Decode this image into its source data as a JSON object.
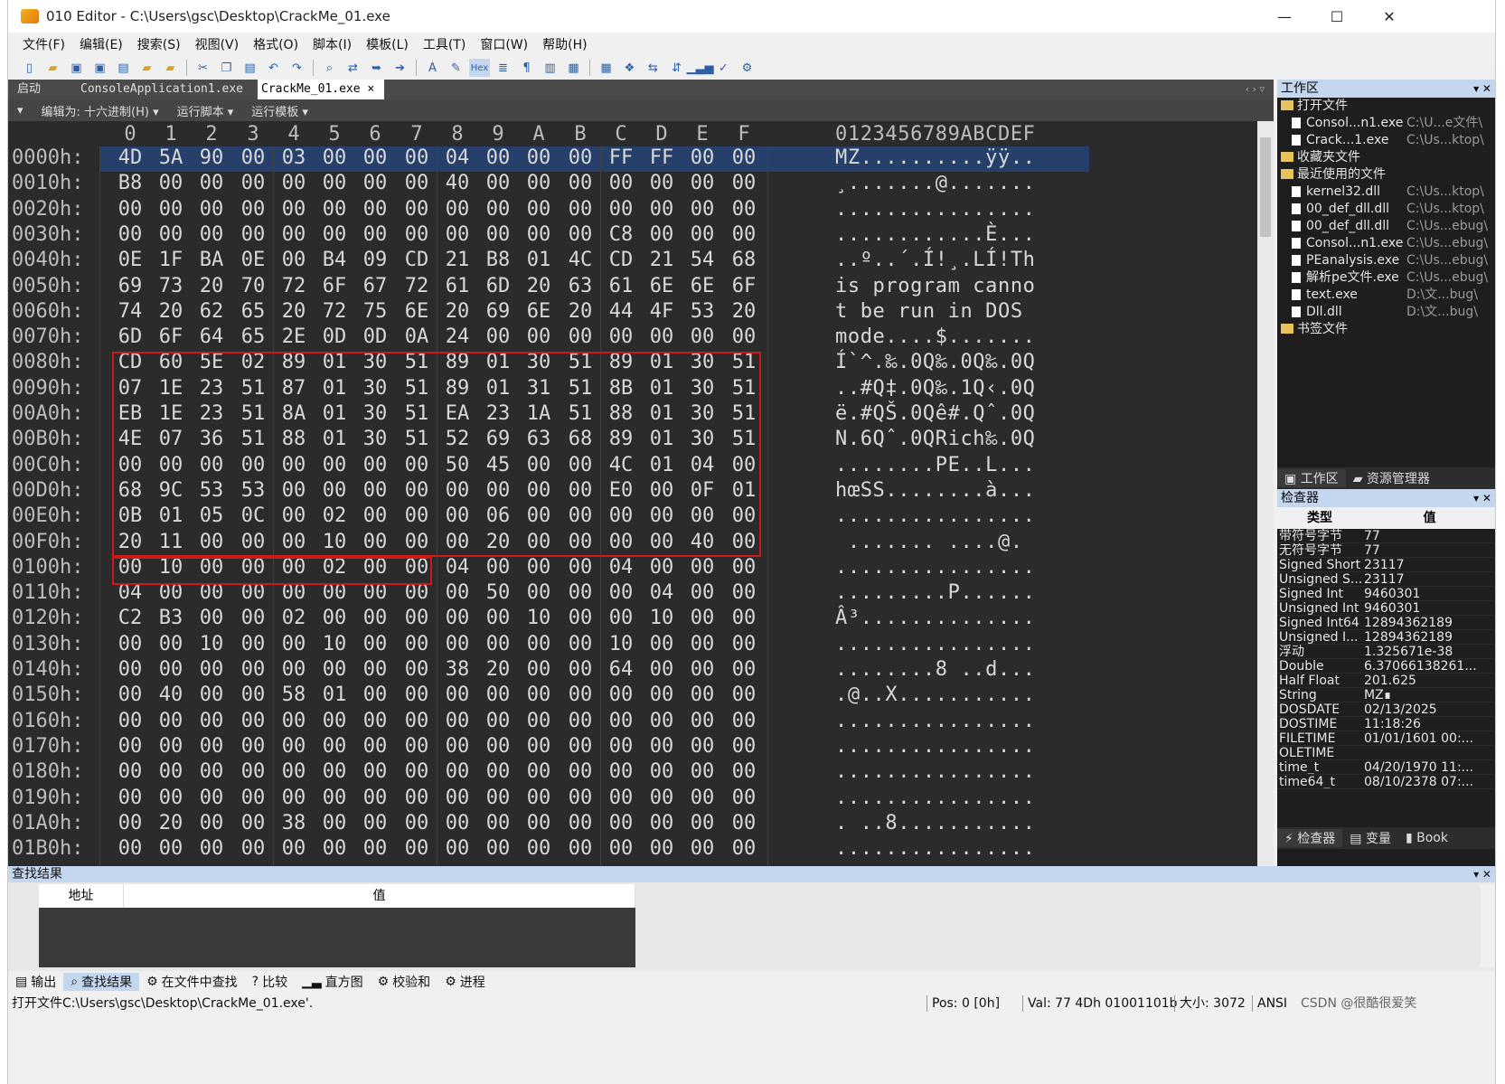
{
  "titlebar": {
    "title": "010 Editor - C:\\Users\\gsc\\Desktop\\CrackMe_01.exe",
    "min": "—",
    "max": "☐",
    "close": "✕"
  },
  "menu": [
    "文件(F)",
    "编辑(E)",
    "搜索(S)",
    "视图(V)",
    "格式(O)",
    "脚本(I)",
    "模板(L)",
    "工具(T)",
    "窗口(W)",
    "帮助(H)"
  ],
  "tabs": {
    "start": "启动",
    "file1": "ConsoleApplication1.exe",
    "file2": "CrackMe_01.exe",
    "close": "×",
    "arrows": "‹ › ▿"
  },
  "subbar": {
    "collapse": "▾",
    "edit_as": "编辑为: 十六进制(H) ▾",
    "run_script": "运行脚本 ▾",
    "run_template": "运行模板 ▾"
  },
  "hex": {
    "col_headers": [
      "0",
      "1",
      "2",
      "3",
      "4",
      "5",
      "6",
      "7",
      "8",
      "9",
      "A",
      "B",
      "C",
      "D",
      "E",
      "F"
    ],
    "ascii_header": "0123456789ABCDEF",
    "rows": [
      {
        "addr": "0000h:",
        "bytes": [
          "4D",
          "5A",
          "90",
          "00",
          "03",
          "00",
          "00",
          "00",
          "04",
          "00",
          "00",
          "00",
          "FF",
          "FF",
          "00",
          "00"
        ],
        "ascii": "MZ..........ÿÿ.."
      },
      {
        "addr": "0010h:",
        "bytes": [
          "B8",
          "00",
          "00",
          "00",
          "00",
          "00",
          "00",
          "00",
          "40",
          "00",
          "00",
          "00",
          "00",
          "00",
          "00",
          "00"
        ],
        "ascii": "¸.......@......."
      },
      {
        "addr": "0020h:",
        "bytes": [
          "00",
          "00",
          "00",
          "00",
          "00",
          "00",
          "00",
          "00",
          "00",
          "00",
          "00",
          "00",
          "00",
          "00",
          "00",
          "00"
        ],
        "ascii": "................"
      },
      {
        "addr": "0030h:",
        "bytes": [
          "00",
          "00",
          "00",
          "00",
          "00",
          "00",
          "00",
          "00",
          "00",
          "00",
          "00",
          "00",
          "C8",
          "00",
          "00",
          "00"
        ],
        "ascii": "............È..."
      },
      {
        "addr": "0040h:",
        "bytes": [
          "0E",
          "1F",
          "BA",
          "0E",
          "00",
          "B4",
          "09",
          "CD",
          "21",
          "B8",
          "01",
          "4C",
          "CD",
          "21",
          "54",
          "68"
        ],
        "ascii": "..º..´.Í!¸.LÍ!Th"
      },
      {
        "addr": "0050h:",
        "bytes": [
          "69",
          "73",
          "20",
          "70",
          "72",
          "6F",
          "67",
          "72",
          "61",
          "6D",
          "20",
          "63",
          "61",
          "6E",
          "6E",
          "6F"
        ],
        "ascii": "is program canno"
      },
      {
        "addr": "0060h:",
        "bytes": [
          "74",
          "20",
          "62",
          "65",
          "20",
          "72",
          "75",
          "6E",
          "20",
          "69",
          "6E",
          "20",
          "44",
          "4F",
          "53",
          "20"
        ],
        "ascii": "t be run in DOS "
      },
      {
        "addr": "0070h:",
        "bytes": [
          "6D",
          "6F",
          "64",
          "65",
          "2E",
          "0D",
          "0D",
          "0A",
          "24",
          "00",
          "00",
          "00",
          "00",
          "00",
          "00",
          "00"
        ],
        "ascii": "mode....$......."
      },
      {
        "addr": "0080h:",
        "bytes": [
          "CD",
          "60",
          "5E",
          "02",
          "89",
          "01",
          "30",
          "51",
          "89",
          "01",
          "30",
          "51",
          "89",
          "01",
          "30",
          "51"
        ],
        "ascii": "Í`^.‰.0Q‰.0Q‰.0Q"
      },
      {
        "addr": "0090h:",
        "bytes": [
          "07",
          "1E",
          "23",
          "51",
          "87",
          "01",
          "30",
          "51",
          "89",
          "01",
          "31",
          "51",
          "8B",
          "01",
          "30",
          "51"
        ],
        "ascii": "..#Q‡.0Q‰.1Q‹.0Q"
      },
      {
        "addr": "00A0h:",
        "bytes": [
          "EB",
          "1E",
          "23",
          "51",
          "8A",
          "01",
          "30",
          "51",
          "EA",
          "23",
          "1A",
          "51",
          "88",
          "01",
          "30",
          "51"
        ],
        "ascii": "ë.#QŠ.0Qê#.Qˆ.0Q"
      },
      {
        "addr": "00B0h:",
        "bytes": [
          "4E",
          "07",
          "36",
          "51",
          "88",
          "01",
          "30",
          "51",
          "52",
          "69",
          "63",
          "68",
          "89",
          "01",
          "30",
          "51"
        ],
        "ascii": "N.6Qˆ.0QRich‰.0Q"
      },
      {
        "addr": "00C0h:",
        "bytes": [
          "00",
          "00",
          "00",
          "00",
          "00",
          "00",
          "00",
          "00",
          "50",
          "45",
          "00",
          "00",
          "4C",
          "01",
          "04",
          "00"
        ],
        "ascii": "........PE..L..."
      },
      {
        "addr": "00D0h:",
        "bytes": [
          "68",
          "9C",
          "53",
          "53",
          "00",
          "00",
          "00",
          "00",
          "00",
          "00",
          "00",
          "00",
          "E0",
          "00",
          "0F",
          "01"
        ],
        "ascii": "hœSS........à..."
      },
      {
        "addr": "00E0h:",
        "bytes": [
          "0B",
          "01",
          "05",
          "0C",
          "00",
          "02",
          "00",
          "00",
          "00",
          "06",
          "00",
          "00",
          "00",
          "00",
          "00",
          "00"
        ],
        "ascii": "................"
      },
      {
        "addr": "00F0h:",
        "bytes": [
          "20",
          "11",
          "00",
          "00",
          "00",
          "10",
          "00",
          "00",
          "00",
          "20",
          "00",
          "00",
          "00",
          "00",
          "40",
          "00"
        ],
        "ascii": " ....... ....@."
      },
      {
        "addr": "0100h:",
        "bytes": [
          "00",
          "10",
          "00",
          "00",
          "00",
          "02",
          "00",
          "00",
          "04",
          "00",
          "00",
          "00",
          "04",
          "00",
          "00",
          "00"
        ],
        "ascii": "................"
      },
      {
        "addr": "0110h:",
        "bytes": [
          "04",
          "00",
          "00",
          "00",
          "00",
          "00",
          "00",
          "00",
          "00",
          "50",
          "00",
          "00",
          "00",
          "04",
          "00",
          "00"
        ],
        "ascii": ".........P......"
      },
      {
        "addr": "0120h:",
        "bytes": [
          "C2",
          "B3",
          "00",
          "00",
          "02",
          "00",
          "00",
          "00",
          "00",
          "00",
          "10",
          "00",
          "00",
          "10",
          "00",
          "00"
        ],
        "ascii": "Â³.............."
      },
      {
        "addr": "0130h:",
        "bytes": [
          "00",
          "00",
          "10",
          "00",
          "00",
          "10",
          "00",
          "00",
          "00",
          "00",
          "00",
          "00",
          "10",
          "00",
          "00",
          "00"
        ],
        "ascii": "................"
      },
      {
        "addr": "0140h:",
        "bytes": [
          "00",
          "00",
          "00",
          "00",
          "00",
          "00",
          "00",
          "00",
          "38",
          "20",
          "00",
          "00",
          "64",
          "00",
          "00",
          "00"
        ],
        "ascii": "........8 ..d..."
      },
      {
        "addr": "0150h:",
        "bytes": [
          "00",
          "40",
          "00",
          "00",
          "58",
          "01",
          "00",
          "00",
          "00",
          "00",
          "00",
          "00",
          "00",
          "00",
          "00",
          "00"
        ],
        "ascii": ".@..X..........."
      },
      {
        "addr": "0160h:",
        "bytes": [
          "00",
          "00",
          "00",
          "00",
          "00",
          "00",
          "00",
          "00",
          "00",
          "00",
          "00",
          "00",
          "00",
          "00",
          "00",
          "00"
        ],
        "ascii": "................"
      },
      {
        "addr": "0170h:",
        "bytes": [
          "00",
          "00",
          "00",
          "00",
          "00",
          "00",
          "00",
          "00",
          "00",
          "00",
          "00",
          "00",
          "00",
          "00",
          "00",
          "00"
        ],
        "ascii": "................"
      },
      {
        "addr": "0180h:",
        "bytes": [
          "00",
          "00",
          "00",
          "00",
          "00",
          "00",
          "00",
          "00",
          "00",
          "00",
          "00",
          "00",
          "00",
          "00",
          "00",
          "00"
        ],
        "ascii": "................"
      },
      {
        "addr": "0190h:",
        "bytes": [
          "00",
          "00",
          "00",
          "00",
          "00",
          "00",
          "00",
          "00",
          "00",
          "00",
          "00",
          "00",
          "00",
          "00",
          "00",
          "00"
        ],
        "ascii": "................"
      },
      {
        "addr": "01A0h:",
        "bytes": [
          "00",
          "20",
          "00",
          "00",
          "38",
          "00",
          "00",
          "00",
          "00",
          "00",
          "00",
          "00",
          "00",
          "00",
          "00",
          "00"
        ],
        "ascii": ". ..8..........."
      },
      {
        "addr": "01B0h:",
        "bytes": [
          "00",
          "00",
          "00",
          "00",
          "00",
          "00",
          "00",
          "00",
          "00",
          "00",
          "00",
          "00",
          "00",
          "00",
          "00",
          "00"
        ],
        "ascii": "................"
      }
    ]
  },
  "workspace": {
    "title": "工作区",
    "ctl": "▾ ✕",
    "open_files_label": "打开文件",
    "open_files": [
      {
        "name": "Consol...n1.exe",
        "path": "C:\\U...e文件\\"
      },
      {
        "name": "Crack...1.exe",
        "path": "C:\\Us...ktop\\"
      }
    ],
    "favorites_label": "收藏夹文件",
    "recent_label": "最近使用的文件",
    "recent_files": [
      {
        "name": "kernel32.dll",
        "path": "C:\\Us...ktop\\"
      },
      {
        "name": "00_def_dll.dll",
        "path": "C:\\Us...ktop\\"
      },
      {
        "name": "00_def_dll.dll",
        "path": "C:\\Us...ebug\\"
      },
      {
        "name": "Consol...n1.exe",
        "path": "C:\\Us...ebug\\"
      },
      {
        "name": "PEanalysis.exe",
        "path": "C:\\Us...ebug\\"
      },
      {
        "name": "解析pe文件.exe",
        "path": "C:\\Us...ebug\\"
      },
      {
        "name": "text.exe",
        "path": "D:\\文...bug\\"
      },
      {
        "name": "Dll.dll",
        "path": "D:\\文...bug\\"
      }
    ],
    "bookmarks_label": "书签文件",
    "tab_workspace": "工作区",
    "tab_explorer": "资源管理器"
  },
  "inspector": {
    "title": "检查器",
    "ctl": "▾ ✕",
    "col_type": "类型",
    "col_value": "值",
    "rows": [
      {
        "k": "带符号字节",
        "v": "77"
      },
      {
        "k": "无符号字节",
        "v": "77"
      },
      {
        "k": "Signed Short",
        "v": "23117"
      },
      {
        "k": "Unsigned S...",
        "v": "23117"
      },
      {
        "k": "Signed Int",
        "v": "9460301"
      },
      {
        "k": "Unsigned Int",
        "v": "9460301"
      },
      {
        "k": "Signed Int64",
        "v": "12894362189"
      },
      {
        "k": "Unsigned I...",
        "v": "12894362189"
      },
      {
        "k": "浮动",
        "v": "1.325671e-38"
      },
      {
        "k": "Double",
        "v": "6.37066138261..."
      },
      {
        "k": "Half Float",
        "v": "201.625"
      },
      {
        "k": "String",
        "v": "MZ∎"
      },
      {
        "k": "DOSDATE",
        "v": "02/13/2025"
      },
      {
        "k": "DOSTIME",
        "v": "11:18:26"
      },
      {
        "k": "FILETIME",
        "v": "01/01/1601 00:..."
      },
      {
        "k": "OLETIME",
        "v": ""
      },
      {
        "k": "time_t",
        "v": "04/20/1970 11:..."
      },
      {
        "k": "time64_t",
        "v": "08/10/2378 07:..."
      }
    ],
    "tab_inspector": "检查器",
    "tab_vars": "变量",
    "tab_book": "Book"
  },
  "find": {
    "title": "查找结果",
    "ctl": "▾ ✕",
    "col_addr": "地址",
    "col_value": "值"
  },
  "bottom_tabs": [
    "输出",
    "查找结果",
    "在文件中查找",
    "比较",
    "直方图",
    "校验和",
    "进程"
  ],
  "status": {
    "message": "打开文件C:\\Users\\gsc\\Desktop\\CrackMe_01.exe'.",
    "pos": "Pos: 0 [0h]",
    "val": "Val: 77 4Dh 01001101b",
    "size": "大小: 3072",
    "ansi": "ANSI",
    "watermark": "CSDN @很酷很爱笑"
  }
}
